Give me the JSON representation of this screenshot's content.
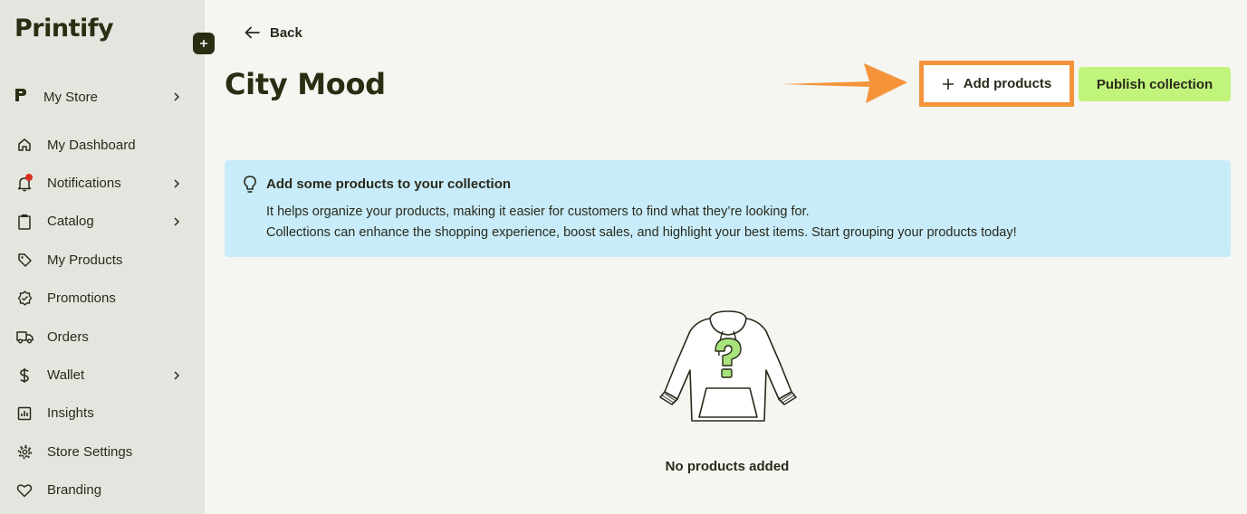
{
  "sidebar": {
    "logo": "Printify",
    "store": {
      "label": "My Store"
    },
    "items": [
      {
        "label": "My Dashboard",
        "icon": "home-icon",
        "chevron": false
      },
      {
        "label": "Notifications",
        "icon": "bell-icon",
        "chevron": true,
        "badge": true
      },
      {
        "label": "Catalog",
        "icon": "clipboard-icon",
        "chevron": true
      },
      {
        "label": "My Products",
        "icon": "tag-icon",
        "chevron": false
      },
      {
        "label": "Promotions",
        "icon": "badge-check-icon",
        "chevron": false
      },
      {
        "label": "Orders",
        "icon": "truck-icon",
        "chevron": false
      },
      {
        "label": "Wallet",
        "icon": "dollar-icon",
        "chevron": true
      },
      {
        "label": "Insights",
        "icon": "chart-icon",
        "chevron": false
      },
      {
        "label": "Store Settings",
        "icon": "gear-icon",
        "chevron": false
      },
      {
        "label": "Branding",
        "icon": "heart-icon",
        "chevron": false
      }
    ]
  },
  "header": {
    "back_label": "Back",
    "title": "City Mood",
    "add_products_label": "Add products",
    "publish_label": "Publish collection"
  },
  "info": {
    "title": "Add some products to your collection",
    "line1": "It helps organize your products, making it easier for customers to find what they’re looking for.",
    "line2": "Collections can enhance the shopping experience, boost sales, and highlight your best items. Start grouping your products today!"
  },
  "empty_state": {
    "text": "No products added"
  },
  "colors": {
    "accent_green": "#c1f47b",
    "info_blue": "#c8ecfa",
    "annotation_orange": "#f4933a",
    "brand_dark": "#2b2d13"
  }
}
